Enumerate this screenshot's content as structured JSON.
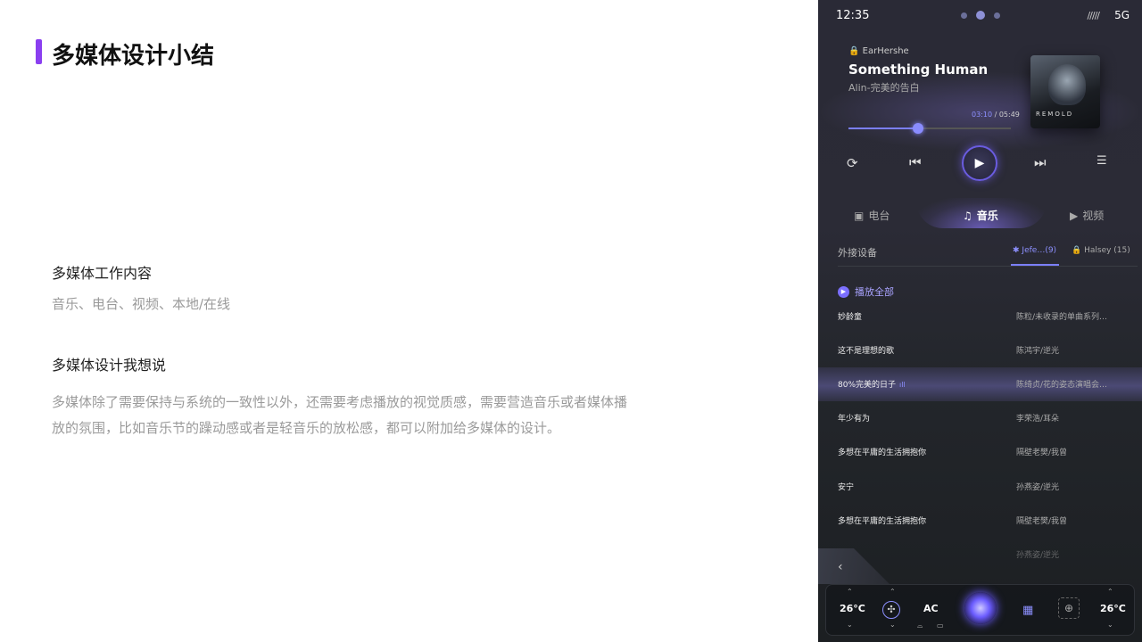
{
  "slide": {
    "title": "多媒体设计小结",
    "section1_heading": "多媒体工作内容",
    "section1_text": "音乐、电台、视频、本地/在线",
    "section2_heading": "多媒体设计我想说",
    "section2_line1": "多媒体除了需要保持与系统的一致性以外，还需要考虑播放的视觉质感，需要营造音乐或者媒体播",
    "section2_line2": "放的氛围，比如音乐节的躁动感或者是轻音乐的放松感，都可以附加给多媒体的设计。"
  },
  "status": {
    "time": "12:35",
    "network": "5G"
  },
  "player": {
    "album_meta": "EarHershe",
    "song_title": "Something  Human",
    "artist": "Alin-完美的告白",
    "cover_label": "REMOLD",
    "current_time": "03:10",
    "separator": " / ",
    "total_time": "05:49",
    "progress": 0.43
  },
  "tabs": {
    "radio": "电台",
    "music": "音乐",
    "video": "视频",
    "active": "music"
  },
  "devices": {
    "label": "外接设备",
    "device1": "Jefe…(9)",
    "device2": "Halsey (15)"
  },
  "playlist": {
    "play_all": "播放全部",
    "songs": [
      {
        "name": "妙龄童",
        "artist": "陈粒/未收录的单曲系列…"
      },
      {
        "name": "这不是理想的歌",
        "artist": "陈鸿宇/逆光"
      },
      {
        "name": "80%完美的日子",
        "artist": "陈绮贞/花的姿态演唱会…",
        "active": true
      },
      {
        "name": "年少有为",
        "artist": "李荣浩/耳朵"
      },
      {
        "name": "多想在平庸的生活拥抱你",
        "artist": "隔壁老樊/我曾"
      },
      {
        "name": "安宁",
        "artist": "孙燕姿/逆光"
      },
      {
        "name": "多想在平庸的生活拥抱你",
        "artist": "隔壁老樊/我曾"
      },
      {
        "name": "",
        "artist": "孙燕姿/逆光"
      }
    ]
  },
  "climate": {
    "left_temp": "26°C",
    "right_temp": "26°C",
    "ac": "AC"
  },
  "colors": {
    "accent": "#7b7fff",
    "brand_bar": "#8a3ff0"
  }
}
